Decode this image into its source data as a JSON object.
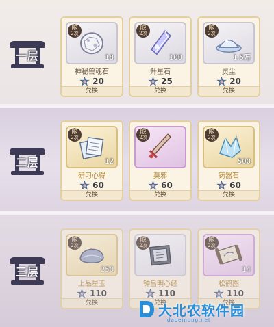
{
  "currency_icon": "star-flower-token-icon",
  "limit_badge": {
    "line1": "限",
    "line2": "2次"
  },
  "tiers": [
    {
      "label": "一层",
      "items": [
        {
          "name": "神秘兽魂石",
          "qty": "18",
          "cost": "20",
          "button": "兑换",
          "icon": "spirit-stone-icon"
        },
        {
          "name": "升星石",
          "qty": "100",
          "cost": "25",
          "button": "兑换",
          "icon": "star-upgrade-stone-icon"
        },
        {
          "name": "灵尘",
          "qty": "1.5万",
          "cost": "20",
          "button": "兑换",
          "icon": "spirit-dust-icon"
        }
      ]
    },
    {
      "label": "二层",
      "items": [
        {
          "name": "研习心得",
          "qty": "12",
          "cost": "60",
          "button": "兑换",
          "icon": "study-notes-icon"
        },
        {
          "name": "莫邪",
          "qty": "",
          "cost": "60",
          "button": "兑换",
          "icon": "moye-sword-icon"
        },
        {
          "name": "铸器石",
          "qty": "500",
          "cost": "60",
          "button": "兑换",
          "icon": "forging-stone-icon"
        }
      ]
    },
    {
      "label": "三层",
      "items": [
        {
          "name": "上品星玉",
          "qty": "250",
          "cost": "110",
          "button": "兑换",
          "icon": "star-jade-icon"
        },
        {
          "name": "钟吕明心经",
          "qty": "",
          "cost": "110",
          "button": "兑换",
          "icon": "scripture-book-icon"
        },
        {
          "name": "松鹤图",
          "qty": "14",
          "cost": "110",
          "button": "兑换",
          "icon": "pine-crane-scroll-icon"
        }
      ]
    }
  ],
  "watermark": {
    "text": "大北农软件园",
    "url": "dabeinong.net"
  }
}
